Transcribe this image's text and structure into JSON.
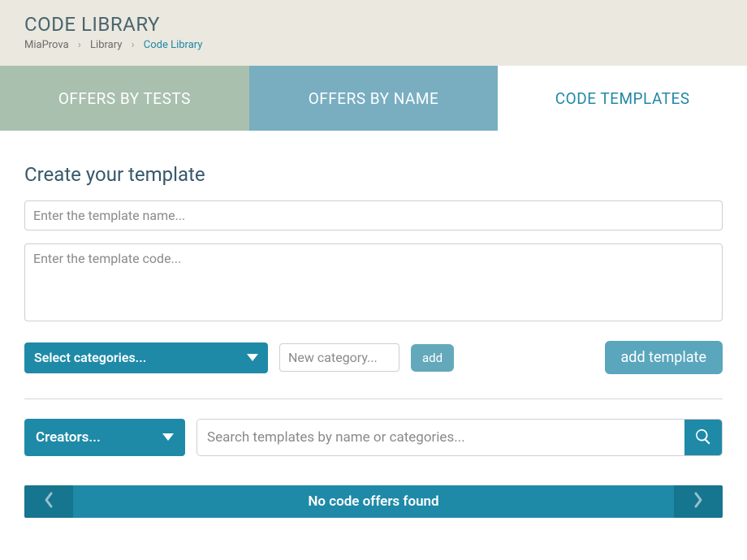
{
  "header": {
    "title": "CODE LIBRARY",
    "breadcrumb": {
      "home": "MiaProva",
      "mid": "Library",
      "current": "Code Library"
    }
  },
  "tabs": {
    "tests": "OFFERS BY TESTS",
    "name": "OFFERS BY NAME",
    "templates": "CODE TEMPLATES"
  },
  "create": {
    "heading": "Create your template",
    "name_placeholder": "Enter the template name...",
    "code_placeholder": "Enter the template code...",
    "categories_label": "Select categories...",
    "new_category_placeholder": "New category...",
    "add_label": "add",
    "add_template_label": "add template"
  },
  "filter": {
    "creators_label": "Creators...",
    "search_placeholder": "Search templates by name or categories..."
  },
  "results": {
    "empty_message": "No code offers found"
  }
}
